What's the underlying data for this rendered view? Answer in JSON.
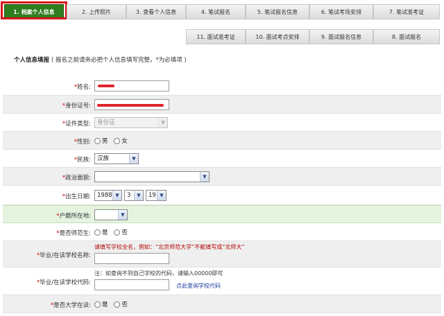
{
  "steps_row1": [
    {
      "label": "1. 档案个人信息",
      "active": true
    },
    {
      "label": "2. 上传照片"
    },
    {
      "label": "3. 查看个人信息"
    },
    {
      "label": "4. 笔试报名"
    },
    {
      "label": "5. 笔试报名信息"
    },
    {
      "label": "6. 笔试考场安排"
    },
    {
      "label": "7. 笔试准考证"
    }
  ],
  "steps_row2": [
    {
      "label": "11. 面试准考证"
    },
    {
      "label": "10. 面试考点安排"
    },
    {
      "label": "9. 面试报名信息"
    },
    {
      "label": "8. 面试报名"
    }
  ],
  "section": {
    "title": "个人信息填报",
    "note": "( 报名之前请务必把个人信息填写完整，*为必填项 )"
  },
  "form": {
    "name_label": "姓名",
    "id_label": "身份证号",
    "idtype_label": "证件类型",
    "idtype_value": "身份证",
    "gender_label": "性别",
    "gender_male": "男",
    "gender_female": "女",
    "ethnic_label": "民族",
    "ethnic_value": "汉族",
    "political_label": "政治面貌",
    "birth_label": "出生日期",
    "birth_year": "1988",
    "birth_month": "3",
    "birth_day": "19",
    "hukou_label": "户籍所在地",
    "normal_label": "是否师范生",
    "yes": "是",
    "no": "否",
    "school_name_label": "毕业/在读学校名称",
    "school_name_hint": "请填写学校全名，例如：“北京师范大学”不能填写成“北师大”",
    "school_code_label": "毕业/在读学校代码",
    "school_code_hint": "注：如查询不到自己学校的代码，请输入00000即可",
    "school_code_link": "点此查询学校代码",
    "enrolled_label": "是否大学在读"
  },
  "colors": {
    "active_step": "#2e7d1e",
    "frame": "#d8121b",
    "required": "#dd0000",
    "hint": "#b00000",
    "link": "#1a3c9c",
    "highlight_row": "#e4f4df"
  }
}
